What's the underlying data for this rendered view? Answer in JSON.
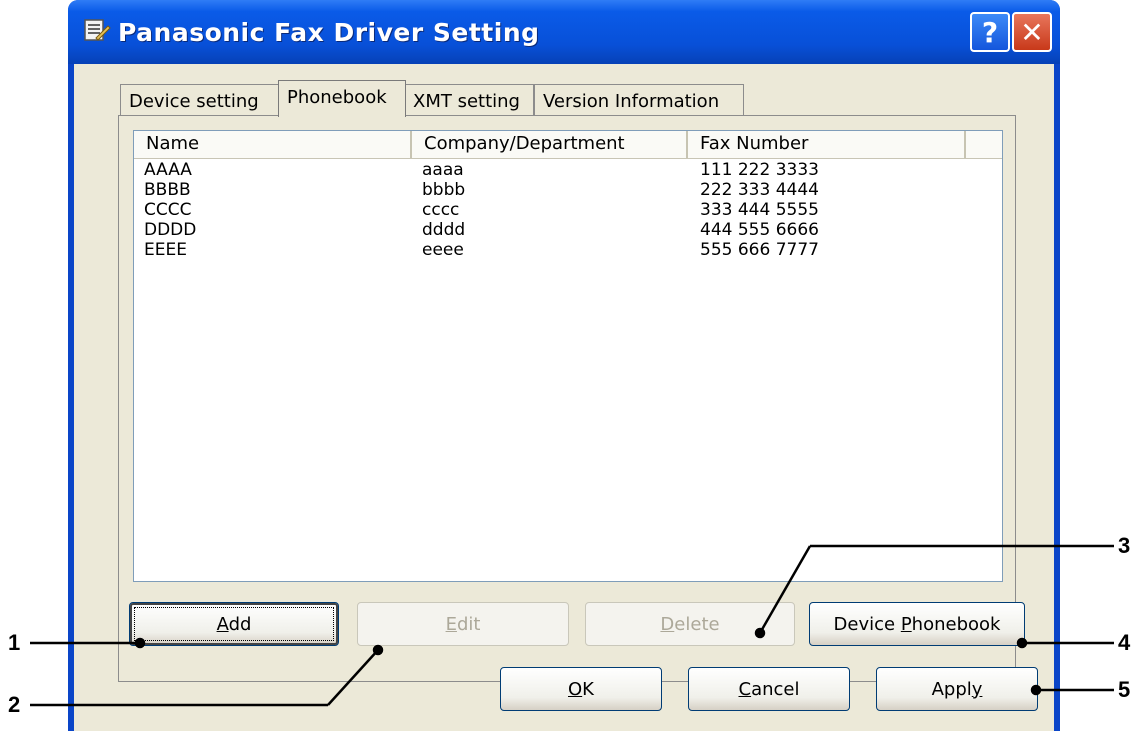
{
  "window": {
    "title": "Panasonic Fax Driver Setting",
    "help_label": "?",
    "close_label": "✕"
  },
  "tabs": [
    {
      "label": "Device setting",
      "active": false
    },
    {
      "label": "Phonebook",
      "active": true
    },
    {
      "label": "XMT setting",
      "active": false
    },
    {
      "label": "Version Information",
      "active": false
    }
  ],
  "phonebook": {
    "columns": [
      "Name",
      "Company/Department",
      "Fax Number"
    ],
    "rows": [
      [
        "AAAA",
        "aaaa",
        "111 222 3333"
      ],
      [
        "BBBB",
        "bbbb",
        "222 333 4444"
      ],
      [
        "CCCC",
        "cccc",
        "333 444 5555"
      ],
      [
        "DDDD",
        "dddd",
        "444 555 6666"
      ],
      [
        "EEEE",
        "eeee",
        "555 666 7777"
      ]
    ]
  },
  "buttons": {
    "add": {
      "pre": "",
      "ul": "A",
      "post": "dd",
      "enabled": true
    },
    "edit": {
      "pre": "",
      "ul": "E",
      "post": "dit",
      "enabled": false
    },
    "delete": {
      "pre": "",
      "ul": "D",
      "post": "elete",
      "enabled": false
    },
    "device_phonebook": {
      "pre": "Device ",
      "ul": "P",
      "post": "honebook",
      "enabled": true
    },
    "ok": {
      "pre": "",
      "ul": "O",
      "post": "K",
      "enabled": true
    },
    "cancel": {
      "pre": "",
      "ul": "C",
      "post": "ancel",
      "enabled": true
    },
    "apply": {
      "pre": "Appl",
      "ul": "y",
      "post": "",
      "enabled": true
    }
  },
  "callouts": [
    "1",
    "2",
    "3",
    "4",
    "5"
  ]
}
